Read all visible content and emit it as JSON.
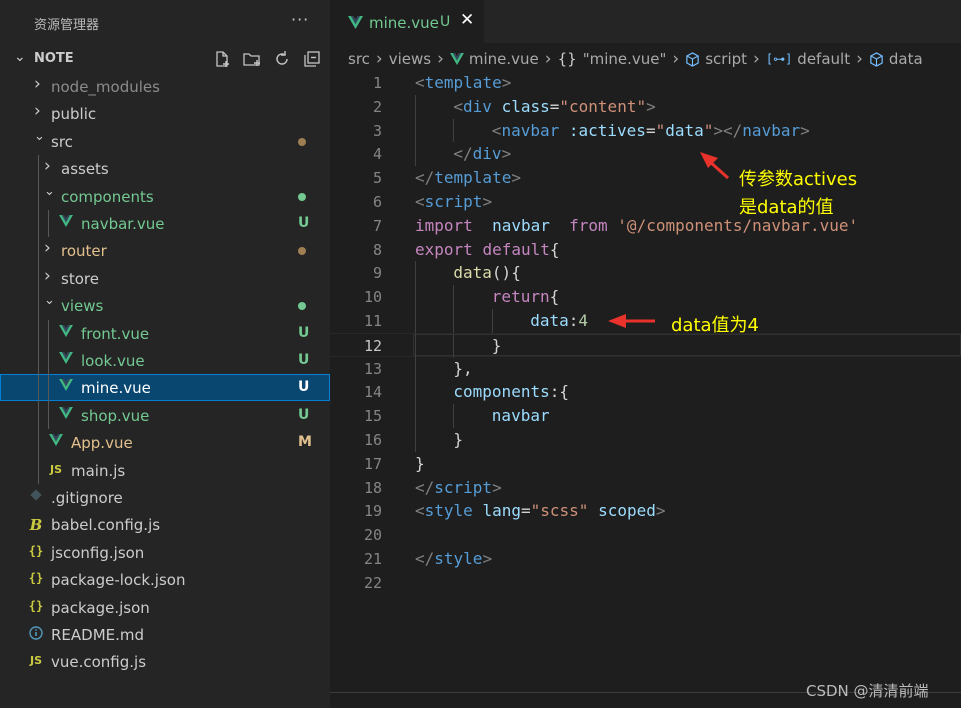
{
  "sidebar": {
    "title": "资源管理器",
    "more_label": "···",
    "section": {
      "label": "NOTE"
    },
    "actions": [
      {
        "icon": "new-file-icon"
      },
      {
        "icon": "new-folder-icon"
      },
      {
        "icon": "refresh-icon"
      },
      {
        "icon": "collapse-all-icon"
      }
    ],
    "tree": [
      {
        "name": "node_modules",
        "kind": "folder",
        "depth": 0,
        "expanded": false,
        "color": "#8c8c8c"
      },
      {
        "name": "public",
        "kind": "folder",
        "depth": 0,
        "expanded": false,
        "color": "#cccccc"
      },
      {
        "name": "src",
        "kind": "folder",
        "depth": 0,
        "expanded": true,
        "color": "#cccccc",
        "status": "dot",
        "status_color": "#a07e53"
      },
      {
        "name": "assets",
        "kind": "folder",
        "depth": 1,
        "expanded": false,
        "color": "#cccccc"
      },
      {
        "name": "components",
        "kind": "folder",
        "depth": 1,
        "expanded": true,
        "color": "#73c991",
        "status": "dot",
        "status_color": "#73c991"
      },
      {
        "name": "navbar.vue",
        "kind": "vue",
        "depth": 2,
        "color": "#73c991",
        "status": "U",
        "status_color": "#73c991"
      },
      {
        "name": "router",
        "kind": "folder",
        "depth": 1,
        "expanded": false,
        "color": "#e2c08d",
        "status": "dot",
        "status_color": "#a07e53"
      },
      {
        "name": "store",
        "kind": "folder",
        "depth": 1,
        "expanded": false,
        "color": "#cccccc"
      },
      {
        "name": "views",
        "kind": "folder",
        "depth": 1,
        "expanded": true,
        "color": "#73c991",
        "status": "dot",
        "status_color": "#73c991"
      },
      {
        "name": "front.vue",
        "kind": "vue",
        "depth": 2,
        "color": "#73c991",
        "status": "U",
        "status_color": "#73c991"
      },
      {
        "name": "look.vue",
        "kind": "vue",
        "depth": 2,
        "color": "#73c991",
        "status": "U",
        "status_color": "#73c991"
      },
      {
        "name": "mine.vue",
        "kind": "vue",
        "depth": 2,
        "color": "#ffffff",
        "status": "U",
        "status_color": "#ffffff",
        "selected": true
      },
      {
        "name": "shop.vue",
        "kind": "vue",
        "depth": 2,
        "color": "#73c991",
        "status": "U",
        "status_color": "#73c991"
      },
      {
        "name": "App.vue",
        "kind": "vue",
        "depth": 1,
        "color": "#e2c08d",
        "status": "M",
        "status_color": "#e2c08d"
      },
      {
        "name": "main.js",
        "kind": "js",
        "depth": 1,
        "color": "#cccccc"
      },
      {
        "name": ".gitignore",
        "kind": "git",
        "depth": 0,
        "color": "#cccccc"
      },
      {
        "name": "babel.config.js",
        "kind": "babel",
        "depth": 0,
        "color": "#cccccc"
      },
      {
        "name": "jsconfig.json",
        "kind": "json",
        "depth": 0,
        "color": "#cccccc"
      },
      {
        "name": "package-lock.json",
        "kind": "json",
        "depth": 0,
        "color": "#cccccc"
      },
      {
        "name": "package.json",
        "kind": "json",
        "depth": 0,
        "color": "#cccccc"
      },
      {
        "name": "README.md",
        "kind": "info",
        "depth": 0,
        "color": "#cccccc"
      },
      {
        "name": "vue.config.js",
        "kind": "js",
        "depth": 0,
        "color": "#cccccc"
      }
    ]
  },
  "editor": {
    "tab": {
      "name": "mine.vue",
      "status": "U",
      "close": "✕"
    },
    "breadcrumbs": [
      {
        "label": "src"
      },
      {
        "label": "views"
      },
      {
        "label": "mine.vue",
        "icon": "vue-icon"
      },
      {
        "label": "\"mine.vue\"",
        "prefix": "{}"
      },
      {
        "label": "script",
        "icon": "cube-icon"
      },
      {
        "label": "default",
        "icon": "bracket-icon"
      },
      {
        "label": "data",
        "icon": "cube-icon"
      }
    ],
    "current_line": 12,
    "lines": [
      {
        "n": "1",
        "indent": 0,
        "tokens": [
          [
            "tag-punct",
            "<"
          ],
          [
            "tag",
            "template"
          ],
          [
            "tag-punct",
            ">"
          ]
        ]
      },
      {
        "n": "2",
        "indent": 1,
        "tokens": [
          [
            "tag-punct",
            "<"
          ],
          [
            "tag",
            "div"
          ],
          [
            "plain",
            " "
          ],
          [
            "attr",
            "class"
          ],
          [
            "plain",
            "="
          ],
          [
            "str",
            "\"content\""
          ],
          [
            "tag-punct",
            ">"
          ]
        ]
      },
      {
        "n": "3",
        "indent": 2,
        "tokens": [
          [
            "tag-punct",
            "<"
          ],
          [
            "tag",
            "navbar"
          ],
          [
            "plain",
            " "
          ],
          [
            "attr",
            ":actives"
          ],
          [
            "plain",
            "="
          ],
          [
            "str",
            "\""
          ],
          [
            "var",
            "data"
          ],
          [
            "str",
            "\""
          ],
          [
            "tag-punct",
            "></"
          ],
          [
            "tag",
            "navbar"
          ],
          [
            "tag-punct",
            ">"
          ]
        ]
      },
      {
        "n": "4",
        "indent": 1,
        "tokens": [
          [
            "tag-punct",
            "</"
          ],
          [
            "tag",
            "div"
          ],
          [
            "tag-punct",
            ">"
          ]
        ]
      },
      {
        "n": "5",
        "indent": 0,
        "tokens": [
          [
            "tag-punct",
            "</"
          ],
          [
            "tag",
            "template"
          ],
          [
            "tag-punct",
            ">"
          ]
        ]
      },
      {
        "n": "6",
        "indent": 0,
        "tokens": [
          [
            "tag-punct",
            "<"
          ],
          [
            "tag",
            "script"
          ],
          [
            "tag-punct",
            ">"
          ]
        ]
      },
      {
        "n": "7",
        "indent": 0,
        "tokens": [
          [
            "kw",
            "import"
          ],
          [
            "plain",
            "  "
          ],
          [
            "var",
            "navbar"
          ],
          [
            "plain",
            "  "
          ],
          [
            "kw",
            "from"
          ],
          [
            "plain",
            " "
          ],
          [
            "str",
            "'@/components/navbar.vue'"
          ]
        ]
      },
      {
        "n": "8",
        "indent": 0,
        "tokens": [
          [
            "kw",
            "export"
          ],
          [
            "plain",
            " "
          ],
          [
            "kw",
            "default"
          ],
          [
            "plain",
            "{"
          ]
        ]
      },
      {
        "n": "9",
        "indent": 1,
        "tokens": [
          [
            "fn",
            "data"
          ],
          [
            "plain",
            "(){"
          ]
        ]
      },
      {
        "n": "10",
        "indent": 2,
        "tokens": [
          [
            "kw",
            "return"
          ],
          [
            "plain",
            "{"
          ]
        ]
      },
      {
        "n": "11",
        "indent": 3,
        "tokens": [
          [
            "var",
            "data"
          ],
          [
            "plain",
            ":"
          ],
          [
            "num",
            "4"
          ]
        ]
      },
      {
        "n": "12",
        "indent": 2,
        "tokens": [
          [
            "plain",
            "}"
          ]
        ]
      },
      {
        "n": "13",
        "indent": 1,
        "tokens": [
          [
            "plain",
            "},"
          ]
        ]
      },
      {
        "n": "14",
        "indent": 1,
        "tokens": [
          [
            "var",
            "components"
          ],
          [
            "plain",
            ":{"
          ]
        ]
      },
      {
        "n": "15",
        "indent": 2,
        "tokens": [
          [
            "var",
            "navbar"
          ]
        ]
      },
      {
        "n": "16",
        "indent": 1,
        "tokens": [
          [
            "plain",
            "}"
          ]
        ]
      },
      {
        "n": "17",
        "indent": 0,
        "tokens": [
          [
            "plain",
            "}"
          ]
        ]
      },
      {
        "n": "18",
        "indent": 0,
        "tokens": [
          [
            "tag-punct",
            "</"
          ],
          [
            "tag",
            "script"
          ],
          [
            "tag-punct",
            ">"
          ]
        ]
      },
      {
        "n": "19",
        "indent": 0,
        "tokens": [
          [
            "tag-punct",
            "<"
          ],
          [
            "tag",
            "style"
          ],
          [
            "plain",
            " "
          ],
          [
            "attr",
            "lang"
          ],
          [
            "plain",
            "="
          ],
          [
            "str",
            "\"scss\""
          ],
          [
            "plain",
            " "
          ],
          [
            "attr",
            "scoped"
          ],
          [
            "tag-punct",
            ">"
          ]
        ]
      },
      {
        "n": "20",
        "indent": 0,
        "tokens": []
      },
      {
        "n": "21",
        "indent": 0,
        "tokens": [
          [
            "tag-punct",
            "</"
          ],
          [
            "tag",
            "style"
          ],
          [
            "tag-punct",
            ">"
          ]
        ]
      },
      {
        "n": "22",
        "indent": 0,
        "tokens": []
      }
    ]
  },
  "annotations": {
    "note1_line1": "传参数actives",
    "note1_line2": "是data的值",
    "note2": "data值为4",
    "arrow_color": "#e8322b",
    "text_color": "#ffff00"
  },
  "watermark": "CSDN @清清前端"
}
